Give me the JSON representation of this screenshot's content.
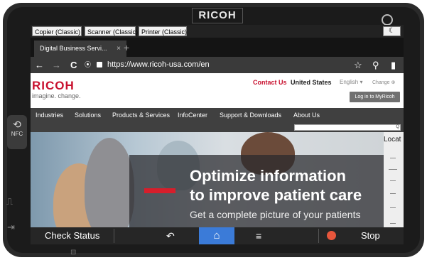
{
  "device": {
    "brand": "RICOH"
  },
  "modes": {
    "copier": "Copier (Classic)",
    "scanner": "Scanner (Classic)",
    "printer": "Printer (Classic)",
    "moon_glyph": "☾"
  },
  "browser": {
    "tab_title": "Digital Business Servi...",
    "tab_close": "×",
    "new_tab": "+",
    "back": "←",
    "forward": "→",
    "reload": "C",
    "url": "https://www.ricoh-usa.com/en",
    "star": "☆",
    "search": "⚲",
    "bookmark": "▮"
  },
  "header": {
    "logo": "RICOH",
    "tagline": "imagine. change.",
    "contact": "Contact Us",
    "country": "United States",
    "language": "English ▾",
    "change": "Change ⊕",
    "login": "Log in to MyRicoh"
  },
  "nav": {
    "items": [
      "Industries",
      "Solutions",
      "Products & Services",
      "InfoCenter",
      "Support & Downloads",
      "About Us"
    ],
    "search_glyph": "Q"
  },
  "hero": {
    "title_line1": "Optimize information",
    "title_line2": "to improve patient care",
    "subtitle": "Get a complete picture of your patients"
  },
  "side_panel": {
    "label": "Locat"
  },
  "bottom_bar": {
    "check_status": "Check Status",
    "back_glyph": "↶",
    "home_glyph": "⌂",
    "menu_glyph": "≡",
    "stop": "Stop"
  },
  "colors": {
    "ricoh_red": "#c8102e",
    "home_blue": "#3b7bd8",
    "stop_orange": "#e7563c"
  }
}
